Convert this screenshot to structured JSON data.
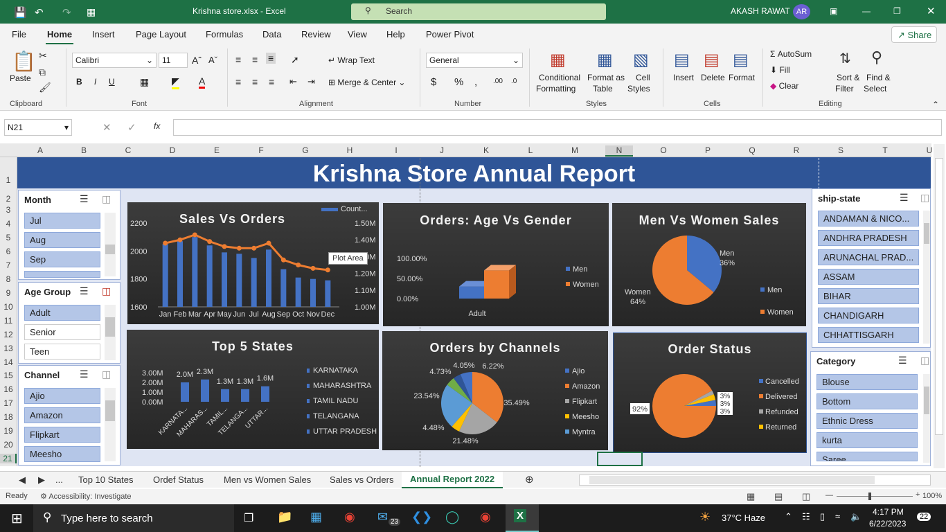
{
  "window": {
    "file_title": "Krishna store.xlsx  -  Excel",
    "search": "Search",
    "user": "AKASH RAWAT",
    "initials": "AR"
  },
  "menu": [
    "File",
    "Home",
    "Insert",
    "Page Layout",
    "Formulas",
    "Data",
    "Review",
    "View",
    "Help",
    "Power Pivot"
  ],
  "share": "Share",
  "ribbon": {
    "paste": "Paste",
    "clipboard": "Clipboard",
    "font_name": "Calibri",
    "font_size": "11",
    "font": "Font",
    "alignment": "Alignment",
    "wrap": "Wrap Text",
    "merge": "Merge & Center",
    "number_format": "General",
    "number": "Number",
    "cond1": "Conditional",
    "cond2": "Formatting",
    "fmt1": "Format as",
    "fmt2": "Table",
    "cell1": "Cell",
    "cell2": "Styles",
    "styles": "Styles",
    "insert": "Insert",
    "delete": "Delete",
    "format": "Format",
    "cells": "Cells",
    "autosum": "AutoSum",
    "fill": "Fill",
    "clear": "Clear",
    "sort1": "Sort &",
    "sort2": "Filter",
    "find1": "Find &",
    "find2": "Select",
    "editing": "Editing"
  },
  "formula": {
    "namebox": "N21",
    "fx": "fx",
    "value": ""
  },
  "columns": [
    "A",
    "B",
    "C",
    "D",
    "E",
    "F",
    "G",
    "H",
    "I",
    "J",
    "K",
    "L",
    "M",
    "N",
    "O",
    "P",
    "Q",
    "R",
    "S",
    "T",
    "U"
  ],
  "rows": [
    "1",
    "2",
    "3",
    "4",
    "5",
    "6",
    "7",
    "8",
    "9",
    "10",
    "11",
    "12",
    "13",
    "14",
    "15",
    "16",
    "17",
    "18",
    "19",
    "20",
    "21"
  ],
  "title": "Krishna Store Annual Report",
  "slicers": {
    "month": {
      "title": "Month",
      "items": [
        "Jul",
        "Aug",
        "Sep"
      ]
    },
    "age": {
      "title": "Age Group",
      "items": [
        "Adult",
        "Senior",
        "Teen"
      ]
    },
    "channel": {
      "title": "Channel",
      "items": [
        "Ajio",
        "Amazon",
        "Flipkart",
        "Meesho"
      ]
    },
    "ship": {
      "title": "ship-state",
      "items": [
        "ANDAMAN & NICO...",
        "ANDHRA PRADESH",
        "ARUNACHAL PRAD...",
        "ASSAM",
        "BIHAR",
        "CHANDIGARH",
        "CHHATTISGARH"
      ]
    },
    "category": {
      "title": "Category",
      "items": [
        "Blouse",
        "Bottom",
        "Ethnic Dress",
        "kurta",
        "Saree"
      ]
    }
  },
  "chart_data": [
    {
      "type": "bar",
      "title": "Sales Vs  Orders",
      "legend": "Count...",
      "tooltip": "Plot Area",
      "categories": [
        "Jan",
        "Feb",
        "Mar",
        "Apr",
        "May",
        "Jun",
        "Jul",
        "Aug",
        "Sep",
        "Oct",
        "Nov",
        "Dec"
      ],
      "series": [
        {
          "name": "Count...",
          "values": [
            2050,
            2070,
            2100,
            2040,
            1990,
            1980,
            1950,
            2010,
            1870,
            1810,
            1800,
            1790
          ]
        },
        {
          "values": [
            1.38,
            1.4,
            1.43,
            1.39,
            1.36,
            1.35,
            1.35,
            1.38,
            1.28,
            1.25,
            1.23,
            1.22
          ]
        }
      ],
      "ylim": [
        1600,
        2200
      ],
      "y_ticks": [
        "2200",
        "2000",
        "1800",
        "1600"
      ],
      "y2lim": [
        1.0,
        1.5
      ],
      "y2_ticks": [
        "1.50M",
        "1.40M",
        "1.30M",
        "1.20M",
        "1.10M",
        "1.00M"
      ]
    },
    {
      "type": "bar",
      "title": "Orders: Age Vs Gender",
      "categories": [
        "Adult"
      ],
      "series": [
        {
          "name": "Men",
          "values": [
            0.3
          ]
        },
        {
          "name": "Women",
          "values": [
            0.7
          ]
        }
      ],
      "y_ticks": [
        "100.00%",
        "50.00%",
        "0.00%"
      ]
    },
    {
      "type": "pie",
      "title": "Men Vs Women Sales",
      "labels": [
        "Men",
        "Women"
      ],
      "values": [
        36,
        64
      ],
      "data_labels": [
        "36%",
        "64%"
      ]
    },
    {
      "type": "bar",
      "title": "Top 5 States",
      "categories": [
        "KARNATA...",
        "MAHARAS...",
        "TAMIL...",
        "TELANGA...",
        "UTTAR..."
      ],
      "series": [
        {
          "name": "KARNATAKA",
          "values": [
            2.0
          ]
        },
        {
          "name": "MAHARASHTRA",
          "values": [
            2.3
          ]
        },
        {
          "name": "TAMIL NADU",
          "values": [
            1.3
          ]
        },
        {
          "name": "TELANGANA",
          "values": [
            1.3
          ]
        },
        {
          "name": "UTTAR PRADESH",
          "values": [
            1.6
          ]
        }
      ],
      "data_labels": [
        "2.0M",
        "2.3M",
        "1.3M",
        "1.3M",
        "1.6M"
      ],
      "y_ticks": [
        "3.00M",
        "2.00M",
        "1.00M",
        "0.00M"
      ]
    },
    {
      "type": "pie",
      "title": "Orders by Channels",
      "labels": [
        "Ajio",
        "Amazon",
        "Flipkart",
        "Meesho",
        "Myntra"
      ],
      "values": [
        35.49,
        21.48,
        4.48,
        23.54,
        4.73,
        4.05,
        6.22
      ],
      "data_labels": [
        "35.49%",
        "21.48%",
        "4.48%",
        "23.54%",
        "4.73%",
        "4.05%",
        "6.22%"
      ]
    },
    {
      "type": "pie",
      "title": "Order Status",
      "labels": [
        "Cancelled",
        "Delivered",
        "Refunded",
        "Returned"
      ],
      "values": [
        3,
        92,
        2,
        3
      ],
      "data_labels": [
        "92%",
        "3%",
        "3%",
        "3%"
      ]
    }
  ],
  "sheet_tabs": [
    "...",
    "Top 10 States",
    "Ordef Status",
    "Men vs Women Sales",
    "Sales vs Orders",
    "Annual Report 2022"
  ],
  "status": {
    "ready": "Ready",
    "access": "Accessibility: Investigate",
    "zoom": "100%"
  },
  "taskbar": {
    "search": "Type here to search",
    "weather": "37°C  Haze",
    "time": "4:17 PM",
    "date": "6/22/2023",
    "notif": "22",
    "mail_badge": "23"
  },
  "colors": {
    "excel_green": "#1e7145",
    "blue": "#4472c4",
    "orange": "#ed7d31",
    "gray": "#a5a5a5",
    "yellow": "#ffc000",
    "lightblue": "#5b9bd5",
    "green": "#70ad47"
  }
}
